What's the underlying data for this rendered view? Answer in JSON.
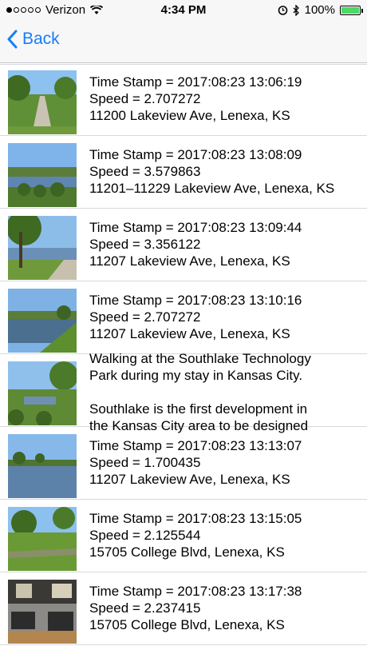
{
  "status_bar": {
    "carrier": "Verizon",
    "signal_bars": 1,
    "time": "4:34 PM",
    "battery_percent": "100%"
  },
  "nav": {
    "back_label": "Back"
  },
  "rows": [
    {
      "scene": "path",
      "line1": "Time Stamp = 2017:08:23 13:06:19",
      "line2": "Speed = 2.707272",
      "line3": "11200 Lakeview Ave, Lenexa, KS"
    },
    {
      "scene": "pond-bushes",
      "line1": "Time Stamp = 2017:08:23 13:08:09",
      "line2": "Speed = 3.579863",
      "line3": "11201–11229 Lakeview Ave, Lenexa, KS"
    },
    {
      "scene": "tree-pond",
      "line1": "Time Stamp = 2017:08:23 13:09:44",
      "line2": "Speed = 3.356122",
      "line3": "11207 Lakeview Ave, Lenexa, KS"
    },
    {
      "scene": "pond-bank",
      "line1": "Time Stamp = 2017:08:23 13:10:16",
      "line2": "Speed = 2.707272",
      "line3": "11207 Lakeview Ave, Lenexa, KS"
    },
    {
      "scene": "park-pond",
      "description_lines": [
        "Walking at the Southlake Technology",
        "Park during my stay in Kansas City.",
        "",
        "Southlake is the first development in",
        "the Kansas City area to be designed"
      ]
    },
    {
      "scene": "lake",
      "line1": "Time Stamp = 2017:08:23 13:13:07",
      "line2": "Speed = 1.700435",
      "line3": "11207 Lakeview Ave, Lenexa, KS"
    },
    {
      "scene": "lawn",
      "line1": "Time Stamp = 2017:08:23 13:15:05",
      "line2": "Speed = 2.125544",
      "line3": "15705 College Blvd, Lenexa, KS"
    },
    {
      "scene": "lobby",
      "line1": "Time Stamp = 2017:08:23 13:17:38",
      "line2": "Speed = 2.237415",
      "line3": "15705 College Blvd, Lenexa, KS"
    }
  ],
  "colors": {
    "accent": "#157efb",
    "battery": "#4cd964",
    "separator": "#d9d9de"
  }
}
